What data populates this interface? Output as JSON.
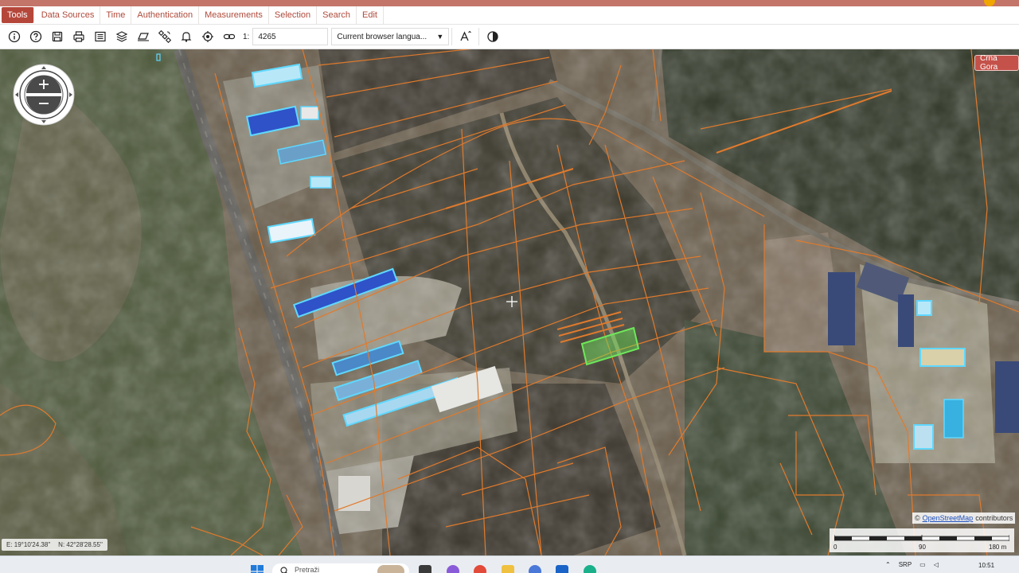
{
  "menubar": {
    "items": [
      {
        "label": "Tools",
        "active": true
      },
      {
        "label": "Data Sources",
        "active": false
      },
      {
        "label": "Time",
        "active": false
      },
      {
        "label": "Authentication",
        "active": false
      },
      {
        "label": "Measurements",
        "active": false
      },
      {
        "label": "Selection",
        "active": false
      },
      {
        "label": "Search",
        "active": false
      },
      {
        "label": "Edit",
        "active": false
      }
    ]
  },
  "toolbar": {
    "icons": [
      "info-icon",
      "help-icon",
      "save-icon",
      "print-icon",
      "list-icon",
      "layers-icon",
      "ruler-icon",
      "satellite-icon",
      "bell-icon",
      "locate-icon",
      "link-icon",
      "text-size-icon",
      "contrast-icon"
    ],
    "scale_prefix": "1:",
    "scale_value": "4265",
    "language_select": "Current browser langua..."
  },
  "map": {
    "country_label": "Crna Gora",
    "attribution": {
      "prefix": "©",
      "link_text": "OpenStreetMap",
      "suffix": "contributors"
    },
    "scalebar": {
      "labels": [
        "0",
        "90",
        "180 m"
      ]
    },
    "coordinates": {
      "easting": "E: 19°10'24.38\"",
      "northing": "N: 42°28'28.55\""
    },
    "colors": {
      "parcel_outline": "#e07a2c",
      "selected_parcel": "#6ee85a",
      "building_highlight": "#5fd8ff"
    }
  },
  "taskbar": {
    "search_placeholder": "Pretraži",
    "tray": {
      "language": "SRP"
    },
    "time": "10:51"
  }
}
